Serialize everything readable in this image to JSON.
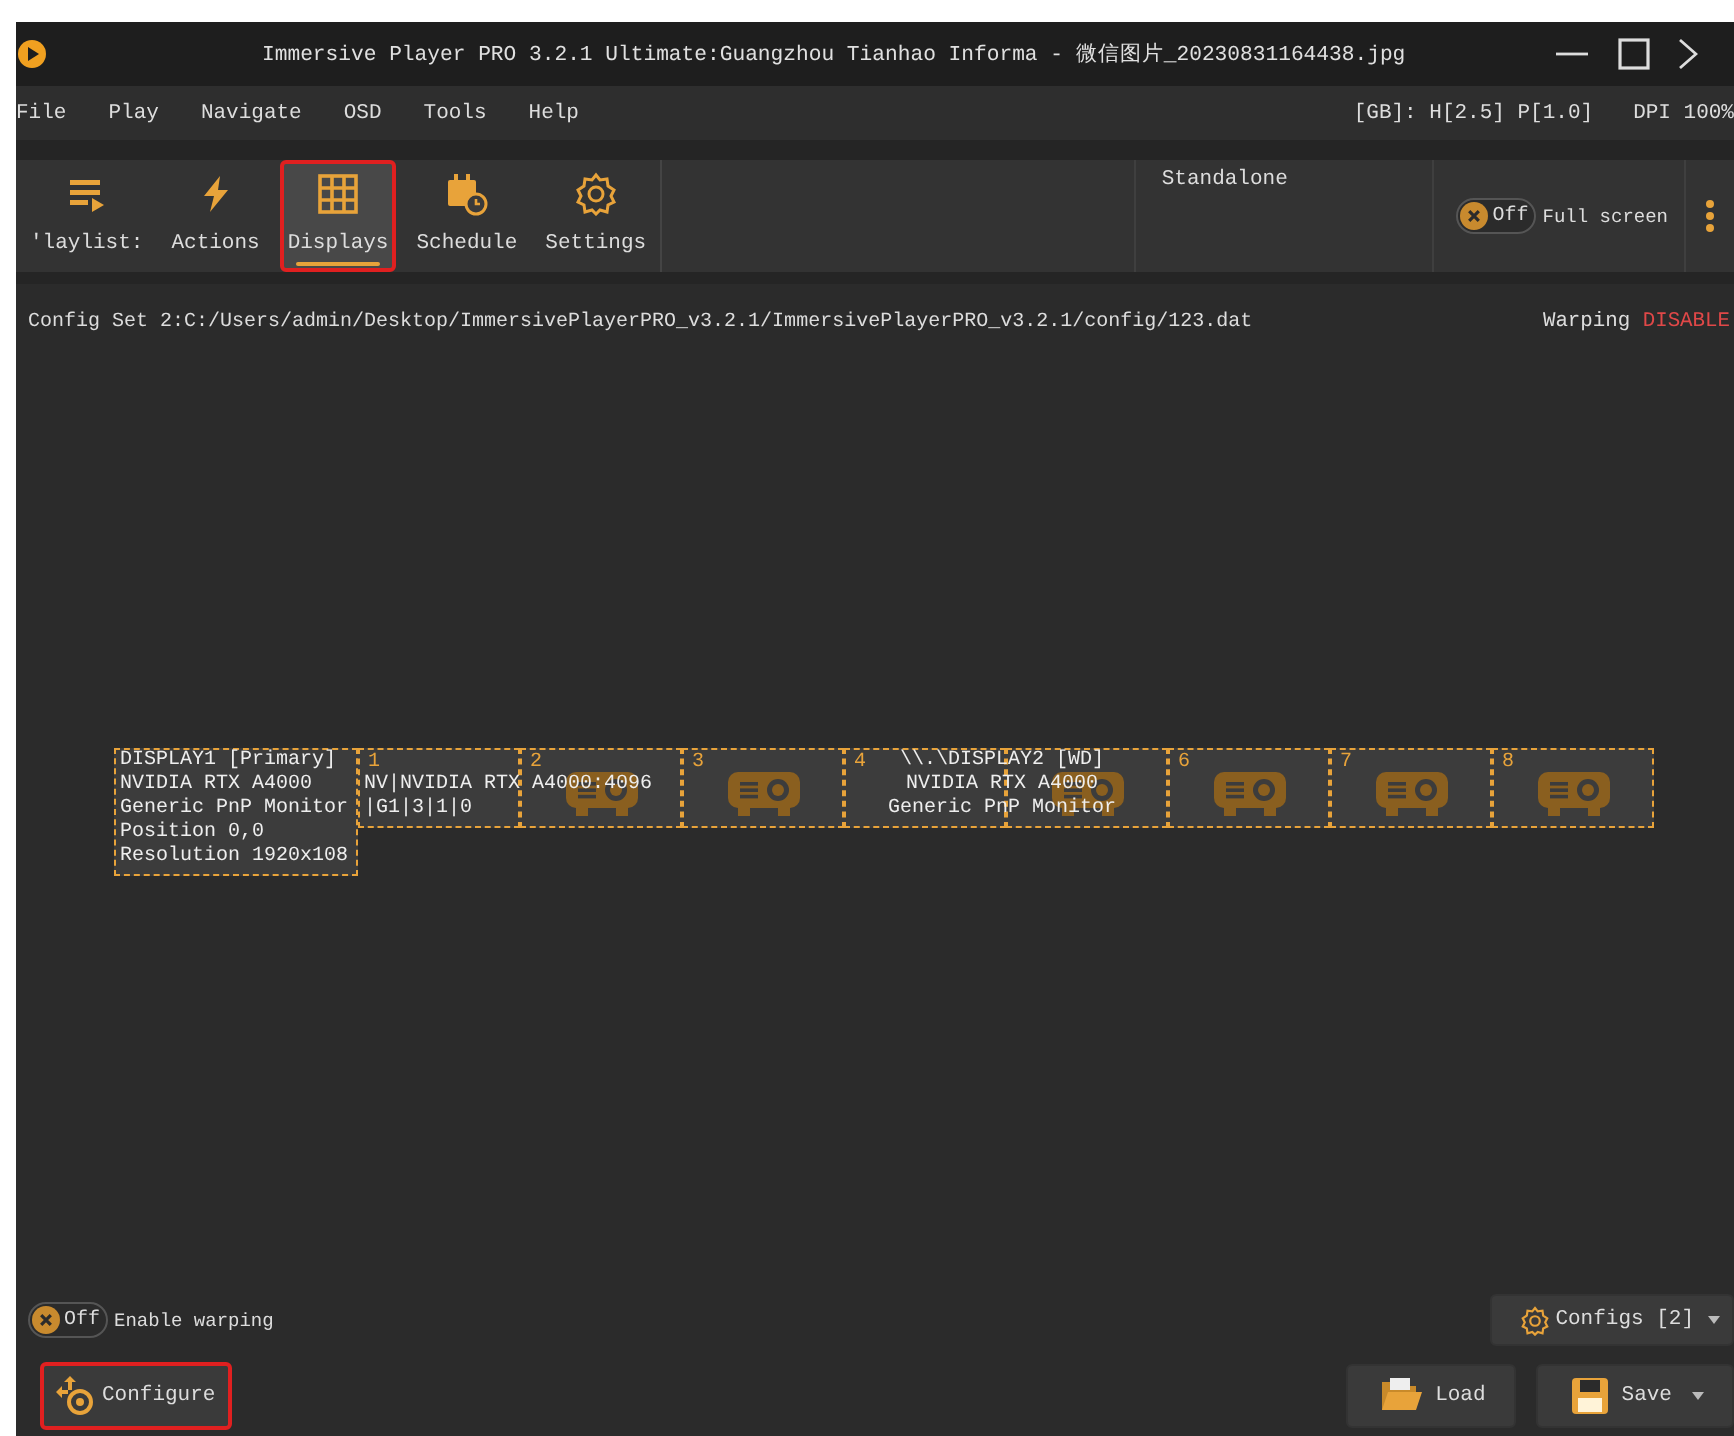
{
  "window": {
    "title": "Immersive Player PRO 3.2.1 Ultimate:Guangzhou Tianhao Informa - 微信图片_20230831164438.jpg"
  },
  "menu": [
    "File",
    "Play",
    "Navigate",
    "OSD",
    "Tools",
    "Help"
  ],
  "status": [
    "[GB]: H[2.5] P[1.0]",
    "DPI 100%"
  ],
  "toolbar": [
    {
      "kind": "playlist",
      "label": "'laylist:",
      "selected": false,
      "highlighted": false
    },
    {
      "kind": "actions",
      "label": "Actions",
      "selected": false,
      "highlighted": false
    },
    {
      "kind": "displays",
      "label": "Displays",
      "selected": true,
      "highlighted": true
    },
    {
      "kind": "schedule",
      "label": "Schedule",
      "selected": false,
      "highlighted": false
    },
    {
      "kind": "settings",
      "label": "Settings",
      "selected": false,
      "highlighted": false
    }
  ],
  "mode": "Standalone",
  "fullscreen": {
    "on": false,
    "state": "Off",
    "label": "Full screen"
  },
  "config_path": "Config Set 2:C:/Users/admin/Desktop/ImmersivePlayerPRO_v3.2.1/ImmersivePlayerPRO_v3.2.1/config/123.dat",
  "warping": {
    "label": "Warping",
    "value": "DISABLE"
  },
  "displays": [
    {
      "kind": "monitor",
      "lines": [
        "DISPLAY1 [Primary]",
        "NVIDIA RTX A4000",
        "Generic PnP Monitor",
        "Position 0,0",
        "Resolution 1920x108"
      ]
    },
    {
      "kind": "monitor",
      "number": "1",
      "lines": [
        "NV|NVIDIA RTX A4000:4096",
        "|G1|3|1|0"
      ]
    },
    {
      "kind": "projector",
      "number": "2"
    },
    {
      "kind": "projector",
      "number": "3"
    },
    {
      "kind": "monitor",
      "number": "4",
      "lines": [
        "\\\\.\\DISPLAY2 [WD]",
        "NVIDIA RTX A4000",
        "Generic PnP Monitor"
      ]
    },
    {
      "kind": "projector"
    },
    {
      "kind": "projector",
      "number": "6"
    },
    {
      "kind": "projector",
      "number": "7"
    },
    {
      "kind": "projector",
      "number": "8"
    }
  ],
  "enable_warping": {
    "on": false,
    "state": "Off",
    "label": "Enable warping"
  },
  "configs_button": "Configs [2]",
  "configure_button": {
    "label": "Configure",
    "highlighted": true
  },
  "load_button": "Load",
  "save_button": "Save"
}
